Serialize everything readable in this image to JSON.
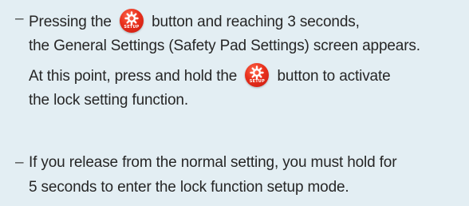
{
  "items": [
    {
      "bullet": "–",
      "lines": [
        {
          "before": "Pressing the",
          "after": "button and reaching 3 seconds,"
        },
        {
          "text": "the General Settings (Safety Pad Settings) screen appears."
        },
        {
          "before": "At this point, press and hold the",
          "after": "button to activate"
        },
        {
          "text": "the lock setting function."
        }
      ]
    },
    {
      "bullet": "–",
      "lines": [
        {
          "text": "If you release from the normal setting, you must hold for"
        },
        {
          "text": "5 seconds to enter the lock function setup mode."
        }
      ]
    }
  ],
  "setup_button": {
    "label": "SETUP",
    "icon": "gear-icon",
    "color": "#e8301c"
  }
}
